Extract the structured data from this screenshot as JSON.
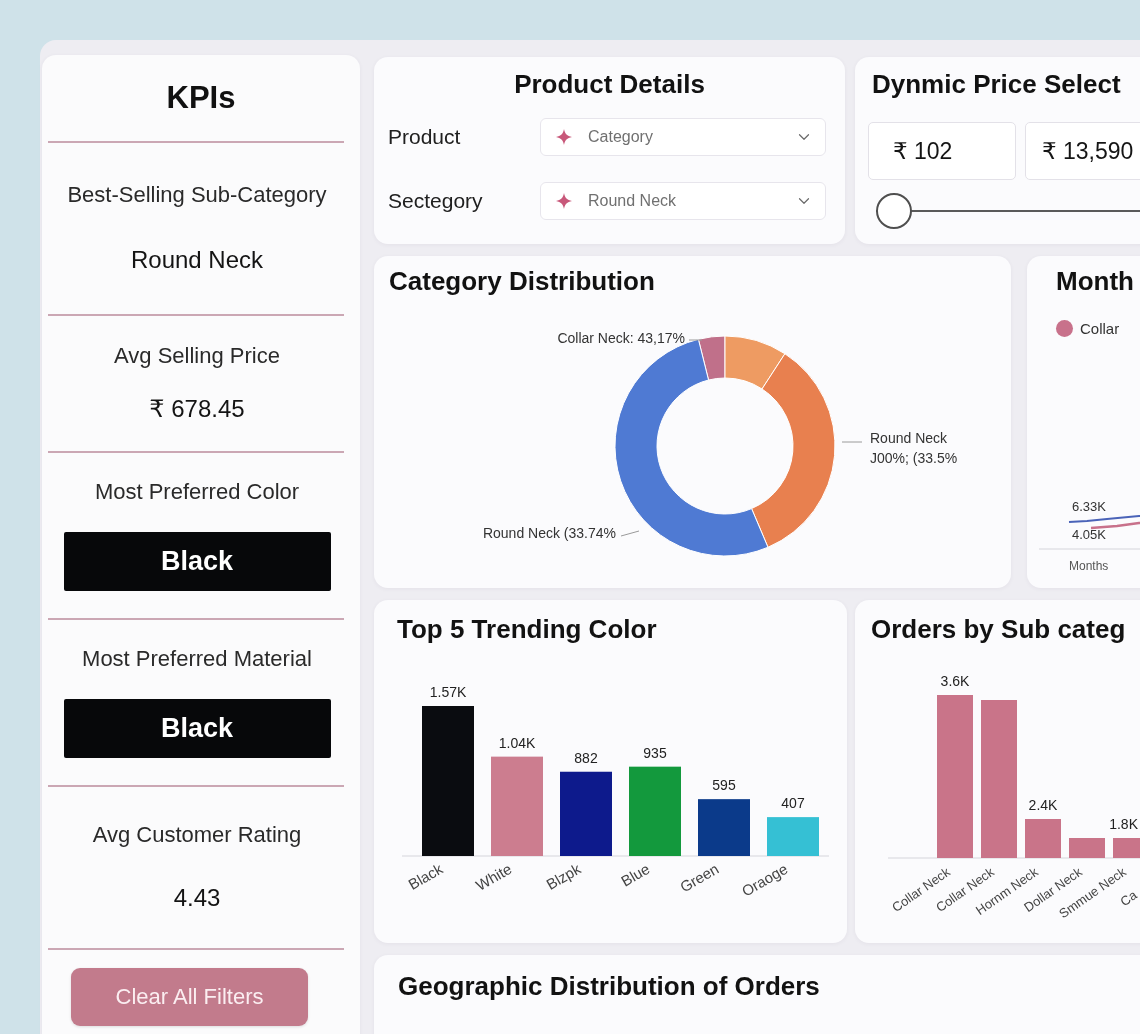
{
  "kpis": {
    "title": "KPIs",
    "items": [
      {
        "kind": "text",
        "label": "Best-Selling Sub-Category",
        "value": "Round Neck"
      },
      {
        "kind": "text",
        "label": "Avg Selling Price",
        "value": "₹ 678.45"
      },
      {
        "kind": "block",
        "label": "Most Preferred Color",
        "value": "Black"
      },
      {
        "kind": "block",
        "label": "Most Preferred Material",
        "value": "Black"
      },
      {
        "kind": "text",
        "label": "Avg Customer Rating",
        "value": "4.43"
      }
    ],
    "clear_button": "Clear All Filters"
  },
  "product_details": {
    "title": "Product Details",
    "filters": [
      {
        "label": "Product",
        "value": "Category"
      },
      {
        "label": "Sectegory",
        "value": "Round Neck"
      }
    ]
  },
  "price_select": {
    "title": "Dynmic Price Select",
    "min_value": "₹ 102",
    "max_value": "₹ 13,590",
    "slider": {
      "level": 0
    }
  },
  "category_distribution": {
    "title": "Category Distribution",
    "slice_labels": [
      {
        "lines": [
          "Collar Neck: 43,17%"
        ]
      },
      {
        "lines": [
          "Round Neck",
          "J00%; (33.5%"
        ]
      },
      {
        "lines": [
          "Round Neck (33.74%"
        ]
      }
    ]
  },
  "month": {
    "title": "Month",
    "legend": [
      {
        "label": "Collar",
        "color": "#c8718b"
      }
    ],
    "point_labels": [
      "6.33K",
      "4.05K"
    ],
    "axis_label": "Months"
  },
  "trending_colors": {
    "title": "Top 5 Trending Color",
    "chart_data": {
      "type": "bar",
      "categories": [
        "Black",
        "White",
        "Blzpk",
        "Blue",
        "Green",
        "Oraoge"
      ],
      "values": [
        1570,
        1040,
        882,
        935,
        595,
        407
      ],
      "colors": [
        "#0a0c10",
        "#cc7d8f",
        "#0d1a8c",
        "#13993d",
        "#0b3a8a",
        "#35c0d4"
      ],
      "value_labels": [
        "1.57K",
        "1.04K",
        "882",
        "935",
        "595",
        "407"
      ]
    }
  },
  "orders_by_subcategory": {
    "title": "Orders by Sub categ",
    "bars": [
      {
        "category": "Collar Neck",
        "value_label": "3.6K"
      },
      {
        "category": "Collar Neck"
      },
      {
        "category": "Hornm Neck",
        "value_label": "2.4K"
      },
      {
        "category": "Dollar Neck"
      },
      {
        "category": "Smmue Neck",
        "value_label": "1.8K"
      },
      {
        "category": "Ca"
      }
    ]
  },
  "geographic_distribution": {
    "title": "Geographic Distribution of Orders"
  }
}
